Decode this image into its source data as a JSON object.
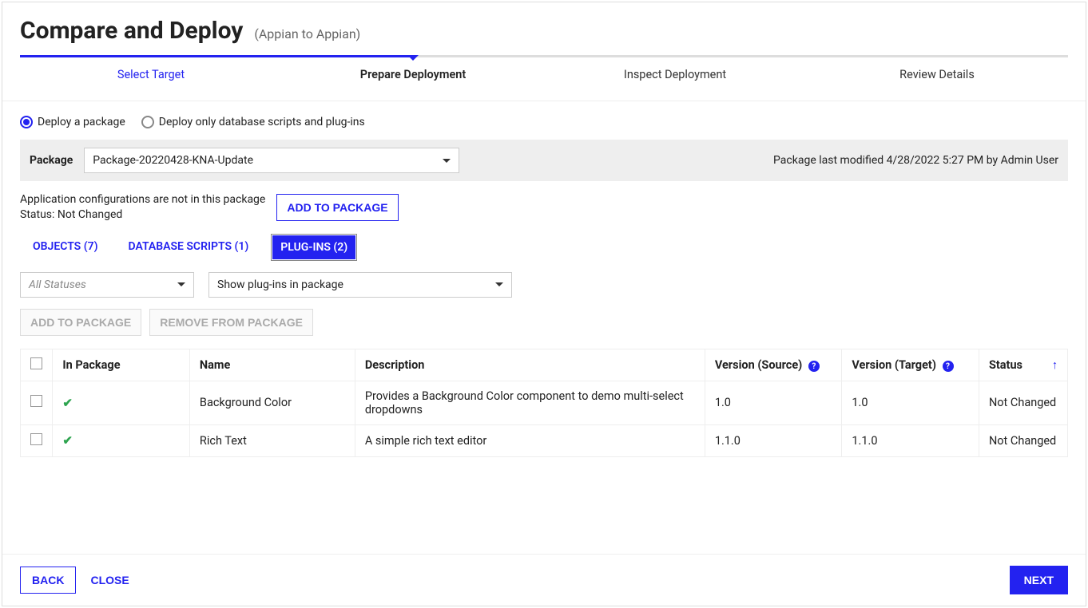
{
  "header": {
    "title": "Compare and Deploy",
    "subtitle": "(Appian to Appian)"
  },
  "steps": [
    "Select Target",
    "Prepare Deployment",
    "Inspect Deployment",
    "Review Details"
  ],
  "radios": {
    "opt1": "Deploy a package",
    "opt2": "Deploy only database scripts and plug-ins"
  },
  "package": {
    "label": "Package",
    "selected": "Package-20220428-KNA-Update",
    "meta": "Package last modified 4/28/2022 5:27 PM by Admin User"
  },
  "config": {
    "line1": "Application configurations are not in this package",
    "line2": "Status: Not Changed",
    "addBtn": "ADD TO PACKAGE"
  },
  "tabs": {
    "objects": "OBJECTS (7)",
    "db": "DATABASE SCRIPTS (1)",
    "plugins": "PLUG-INS (2)"
  },
  "filters": {
    "statusPlaceholder": "All Statuses",
    "scope": "Show plug-ins in package"
  },
  "actions": {
    "add": "ADD TO PACKAGE",
    "remove": "REMOVE FROM PACKAGE"
  },
  "columns": {
    "inPackage": "In Package",
    "name": "Name",
    "description": "Description",
    "versionSource": "Version (Source)",
    "versionTarget": "Version (Target)",
    "status": "Status"
  },
  "rows": [
    {
      "inPackage": true,
      "name": "Background Color",
      "description": "Provides a Background Color component to demo multi-select dropdowns",
      "versionSource": "1.0",
      "versionTarget": "1.0",
      "status": "Not Changed"
    },
    {
      "inPackage": true,
      "name": "Rich Text",
      "description": "A simple rich text editor",
      "versionSource": "1.1.0",
      "versionTarget": "1.1.0",
      "status": "Not Changed"
    }
  ],
  "footer": {
    "back": "BACK",
    "close": "CLOSE",
    "next": "NEXT"
  }
}
